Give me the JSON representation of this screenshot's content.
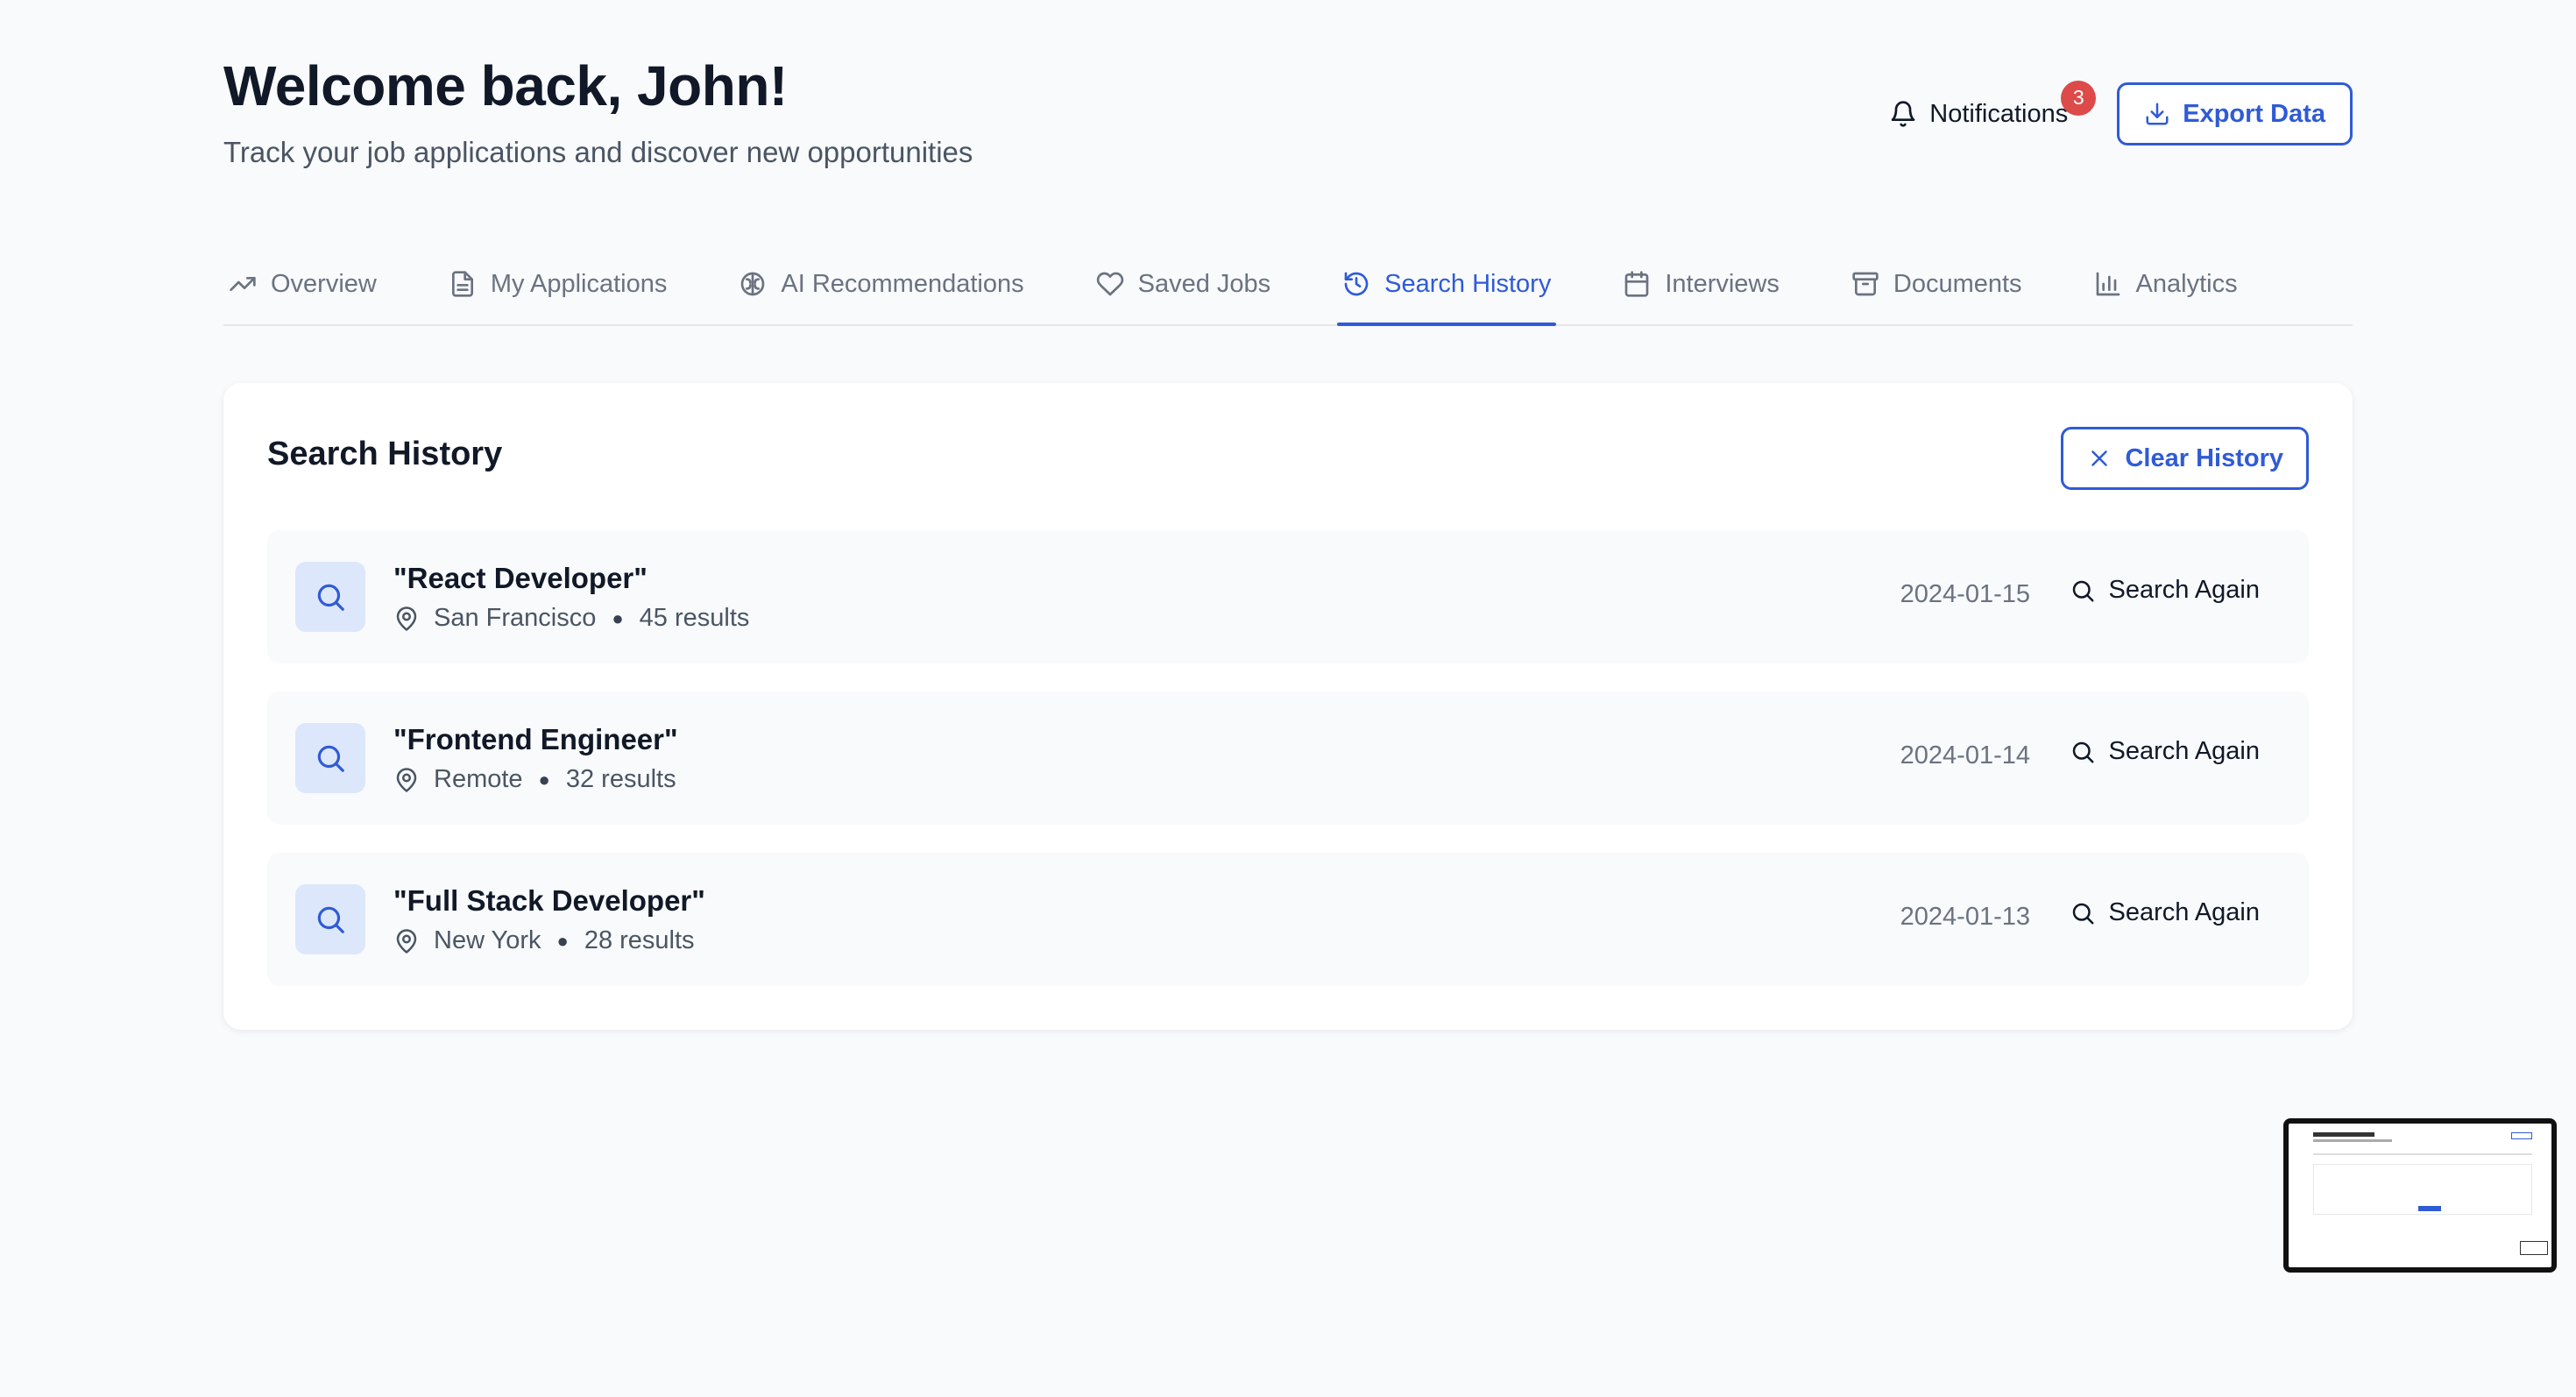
{
  "header": {
    "title": "Welcome back, John!",
    "subtitle": "Track your job applications and discover new opportunities",
    "notifications_label": "Notifications",
    "notifications_count": "3",
    "export_label": "Export Data"
  },
  "tabs": [
    {
      "label": "Overview",
      "icon": "trending-up-icon",
      "active": false
    },
    {
      "label": "My Applications",
      "icon": "document-icon",
      "active": false
    },
    {
      "label": "AI Recommendations",
      "icon": "brain-icon",
      "active": false
    },
    {
      "label": "Saved Jobs",
      "icon": "heart-icon",
      "active": false
    },
    {
      "label": "Search History",
      "icon": "history-icon",
      "active": true
    },
    {
      "label": "Interviews",
      "icon": "calendar-icon",
      "active": false
    },
    {
      "label": "Documents",
      "icon": "archive-icon",
      "active": false
    },
    {
      "label": "Analytics",
      "icon": "bar-chart-icon",
      "active": false
    }
  ],
  "search_history": {
    "title": "Search History",
    "clear_label": "Clear History",
    "items": [
      {
        "query": "\"React Developer\"",
        "location": "San Francisco",
        "results": "45 results",
        "date": "2024-01-15",
        "action": "Search Again"
      },
      {
        "query": "\"Frontend Engineer\"",
        "location": "Remote",
        "results": "32 results",
        "date": "2024-01-14",
        "action": "Search Again"
      },
      {
        "query": "\"Full Stack Developer\"",
        "location": "New York",
        "results": "28 results",
        "date": "2024-01-13",
        "action": "Search Again"
      }
    ]
  },
  "colors": {
    "accent": "#2f5bd6",
    "badge": "#dc4a4a",
    "background": "#f8fafc"
  }
}
